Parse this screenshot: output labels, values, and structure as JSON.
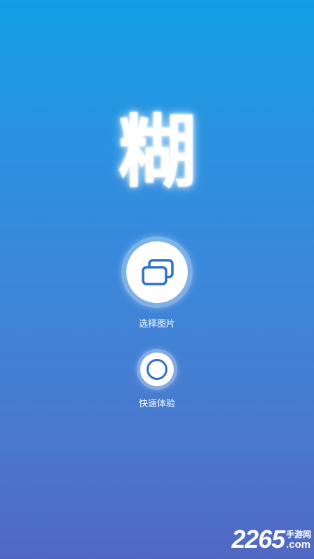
{
  "app": {
    "logo_text": "糊"
  },
  "actions": {
    "select_image_label": "选择图片",
    "quick_experience_label": "快速体验"
  },
  "icons": {
    "select_image": "gallery-stack-icon",
    "quick_experience": "ring-icon"
  },
  "watermark": {
    "digits": "2265",
    "site_cn": "手游网",
    "site_suffix": ".com"
  },
  "colors": {
    "background_top": "#129fe3",
    "background_bottom": "#5068c2",
    "icon_accent": "#2f6fc8"
  }
}
